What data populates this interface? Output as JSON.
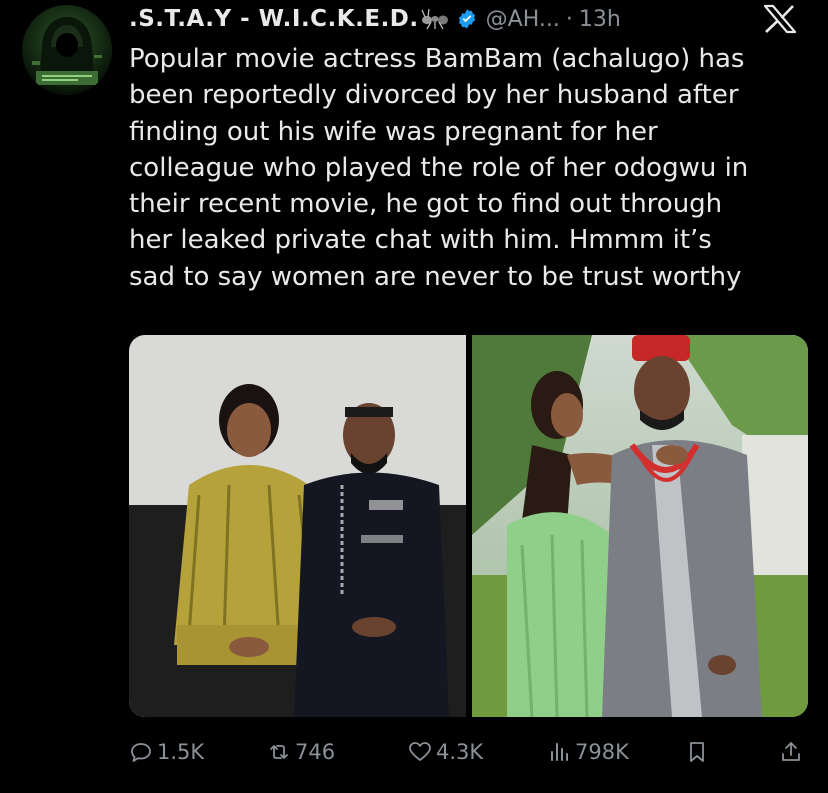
{
  "post": {
    "author_name": ".S.T.A.Y - W.I.C.K.E.D.",
    "handle": "@AH...",
    "separator": "·",
    "time": "13h",
    "platform_icon": "x-logo-icon",
    "verified_icon": "verified-badge-icon",
    "verified_color": "#1d9bf0",
    "text": "Popular movie actress BamBam (achalugo) has\nbeen reportedly divorced by her husband after\nfinding out his wife was pregnant for her\ncolleague who played the role of her odogwu in\ntheir recent movie, he got to find out through\nher leaked private chat with him. Hmmm it’s\nsad to say women are never to be trust worthy"
  },
  "actions": {
    "replies": "1.5K",
    "reposts": "746",
    "likes": "4.3K",
    "views": "798K"
  },
  "colors": {
    "background": "#000000",
    "text": "#e7e9ea",
    "muted": "#8b9197"
  }
}
